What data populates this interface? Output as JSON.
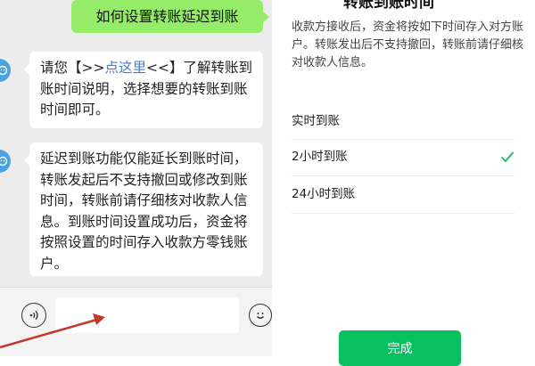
{
  "chat": {
    "user_message": "如何设置转账延迟到账",
    "bot_msg1": {
      "prefix": "请您【>>",
      "link": "点这里",
      "suffix": "<<】了解转账到账时间说明，选择想要的转账到账时间即可。"
    },
    "bot_msg2": "延迟到账功能仅能延长到账时间，转账发起后不支持撤回或修改到账时间，转账前请仔细核对收款人信息。到账时间设置成功后，资金将按照设置的时间存入收款方零钱账户。"
  },
  "sheet": {
    "title": "转账到账时间",
    "description": "收款方接收后，资金将按如下时间存入对方账户。转账发出后不支持撤回，转账前请仔细核对收款人信息。",
    "options": [
      {
        "label": "实时到账",
        "selected": false
      },
      {
        "label": "2小时到账",
        "selected": true
      },
      {
        "label": "24小时到账",
        "selected": false
      }
    ],
    "done_label": "完成"
  },
  "colors": {
    "user_bubble": "#95ec69",
    "accent_green": "#07c160",
    "link_blue": "#4a7dc8",
    "annotation_arrow": "#c0392b"
  },
  "icons": [
    "bot-avatar-icon",
    "voice-icon",
    "emoji-icon",
    "checkmark-icon",
    "annotation-arrow"
  ]
}
